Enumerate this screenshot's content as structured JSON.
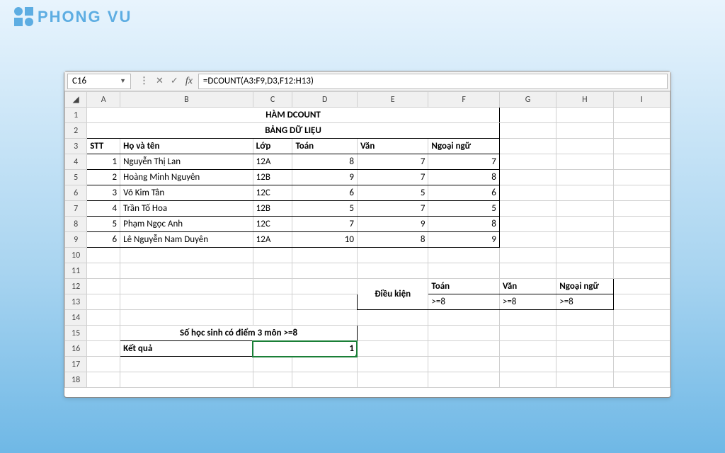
{
  "branding": {
    "logo_text": "PHONG VU"
  },
  "formula_bar": {
    "name_box": "C16",
    "fx_label": "fx",
    "formula": "=DCOUNT(A3:F9,D3,F12:H13)"
  },
  "columns": [
    "A",
    "B",
    "C",
    "D",
    "E",
    "F",
    "G",
    "H",
    "I"
  ],
  "rows": [
    "1",
    "2",
    "3",
    "4",
    "5",
    "6",
    "7",
    "8",
    "9",
    "10",
    "11",
    "12",
    "13",
    "14",
    "15",
    "16",
    "17",
    "18"
  ],
  "titles": {
    "main": "HÀM DCOUNT",
    "sub": "BẢNG DỮ LIỆU"
  },
  "headers": {
    "stt": "STT",
    "name": "Họ và tên",
    "class": "Lớp",
    "math": "Toán",
    "lit": "Văn",
    "lang": "Ngoại ngữ"
  },
  "students": [
    {
      "stt": "1",
      "name": "Nguyễn Thị Lan",
      "class": "12A",
      "math": "8",
      "lit": "7",
      "lang": "7"
    },
    {
      "stt": "2",
      "name": "Hoàng Minh Nguyên",
      "class": "12B",
      "math": "9",
      "lit": "7",
      "lang": "8"
    },
    {
      "stt": "3",
      "name": "Võ Kim Tân",
      "class": "12C",
      "math": "6",
      "lit": "5",
      "lang": "6"
    },
    {
      "stt": "4",
      "name": "Trần Tố Hoa",
      "class": "12B",
      "math": "5",
      "lit": "7",
      "lang": "5"
    },
    {
      "stt": "5",
      "name": "Phạm Ngọc Anh",
      "class": "12C",
      "math": "7",
      "lit": "9",
      "lang": "8"
    },
    {
      "stt": "6",
      "name": "Lê Nguyễn Nam Duyên",
      "class": "12A",
      "math": "10",
      "lit": "8",
      "lang": "9"
    }
  ],
  "criteria": {
    "label": "Điều kiện",
    "h1": "Toán",
    "h2": "Văn",
    "h3": "Ngoại ngữ",
    "v1": ">=8",
    "v2": ">=8",
    "v3": ">=8"
  },
  "summary": {
    "caption": "Số học sinh có điểm 3 môn  >=8",
    "result_label": "Kết quả",
    "result_value": "1"
  }
}
